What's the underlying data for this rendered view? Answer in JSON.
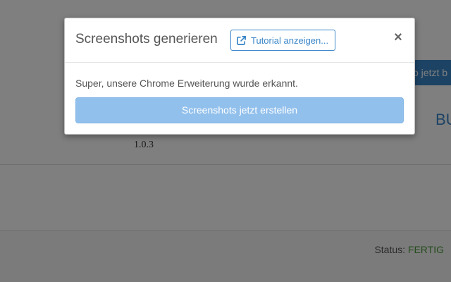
{
  "background": {
    "blue_button_label": "o jetzt b",
    "heading_partial": "BU",
    "version": "1.0.3",
    "status_label": "Status:",
    "status_value": "FERTIG"
  },
  "modal": {
    "title": "Screenshots generieren",
    "tutorial_button": "Tutorial anzeigen...",
    "tutorial_icon": "external-link-icon",
    "close_label": "×",
    "message": "Super, unsere Chrome Erweiterung wurde erkannt.",
    "create_button": "Screenshots jetzt erstellen"
  },
  "colors": {
    "accent": "#3a86c8",
    "disabled_button": "#92c0ec",
    "status_ok": "#4a9a3a"
  }
}
